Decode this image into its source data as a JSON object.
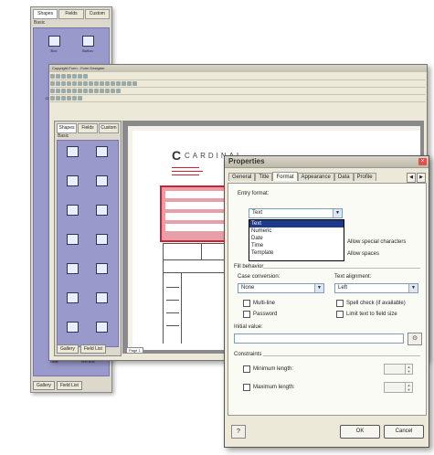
{
  "back_panel": {
    "tabs": [
      "Shapes",
      "Fields",
      "Custom"
    ],
    "category": "Basic",
    "items": [
      "Box",
      "Button",
      "Check box",
      "",
      "Table",
      "Text Box"
    ],
    "bottom_tabs": [
      "Gallery",
      "Field List"
    ]
  },
  "designer": {
    "title": "Copyright Form - Form Designer",
    "inner_tabs": [
      "Shapes",
      "Fields",
      "Custom"
    ],
    "inner_category": "Basic",
    "inner_items": [
      "",
      "",
      "",
      "",
      "",
      "",
      "",
      "",
      "",
      "",
      "",
      "",
      "",
      ""
    ],
    "bottom_tabs": [
      "Gallery",
      "Field List"
    ],
    "page_tab": "Page 1",
    "company_text": "CARDINAL",
    "company_logo_letter": "C"
  },
  "props": {
    "title": "Properties",
    "close_glyph": "×",
    "tabs": [
      "General",
      "Title",
      "Format",
      "Appearance",
      "Data",
      "Profile"
    ],
    "active_tab": "Format",
    "tab_nav_prev": "◀",
    "tab_nav_next": "▶",
    "entry_format_label": "Entry format:",
    "entry_format_value": "Text",
    "dropdown_options": [
      "Text",
      "Numeric",
      "Date",
      "Time",
      "Template"
    ],
    "allow_special": "Allow special characters",
    "allow_spaces": "Allow spaces",
    "fill_behavior_label": "Fill behavior",
    "case_label": "Case conversion:",
    "case_value": "None",
    "text_alignment_label": "Text alignment:",
    "text_alignment_value": "Left",
    "multiline_label": "Multi-line",
    "password_label": "Password",
    "spellcheck_label": "Spell check (if available)",
    "limit_text_label": "Limit text to field size",
    "initial_value_label": "Initial value:",
    "initial_value": "",
    "constraints_label": "Constraints",
    "min_length_label": "Minimum length:",
    "max_length_label": "Maximum length:",
    "help_glyph": "?",
    "ok_label": "OK",
    "cancel_label": "Cancel"
  }
}
